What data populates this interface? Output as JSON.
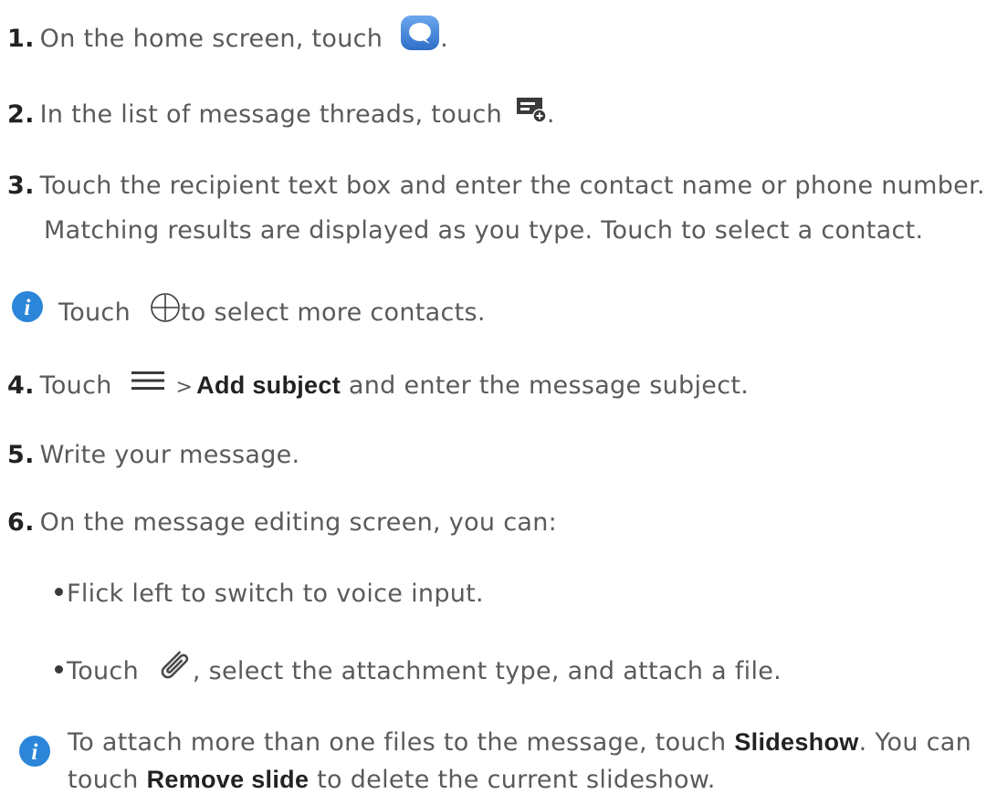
{
  "steps": [
    {
      "num": "1.",
      "text_before": "On the home screen, touch",
      "text_after": ".",
      "icon": "messaging-app-icon"
    },
    {
      "num": "2.",
      "text_before": "In the list of message threads, touch",
      "text_after": ".",
      "icon": "new-message-icon"
    },
    {
      "num": "3.",
      "line1": "Touch the recipient text box and enter the contact name or phone number.",
      "line2": "Matching results are displayed as you type. Touch to select a contact."
    },
    {
      "num": "4.",
      "text_before": "Touch",
      "gt": ">",
      "bold": "Add subject",
      "text_after": "and enter the message subject.",
      "icon": "menu-icon"
    },
    {
      "num": "5.",
      "text": "Write your message."
    },
    {
      "num": "6.",
      "text": "On the message editing screen, you can:"
    }
  ],
  "note1": {
    "before": "Touch",
    "after": "to select more contacts.",
    "icon": "add-circle-icon"
  },
  "bullets": [
    {
      "text": "Flick left to switch to voice input."
    },
    {
      "before": "Touch",
      "after": ", select the attachment type, and attach a file.",
      "icon": "paperclip-icon"
    }
  ],
  "note2": {
    "line1_before": "To attach more than one files to the message, touch",
    "line1_bold": "Slideshow",
    "line1_after": ". You can",
    "line2_before": "touch",
    "line2_bold": "Remove slide",
    "line2_after": "to delete the current slideshow."
  },
  "colors": {
    "info_icon": "#2b86d9",
    "app_icon": "#3a7fd5",
    "text": "#5a5a5a",
    "bold": "#222222"
  }
}
